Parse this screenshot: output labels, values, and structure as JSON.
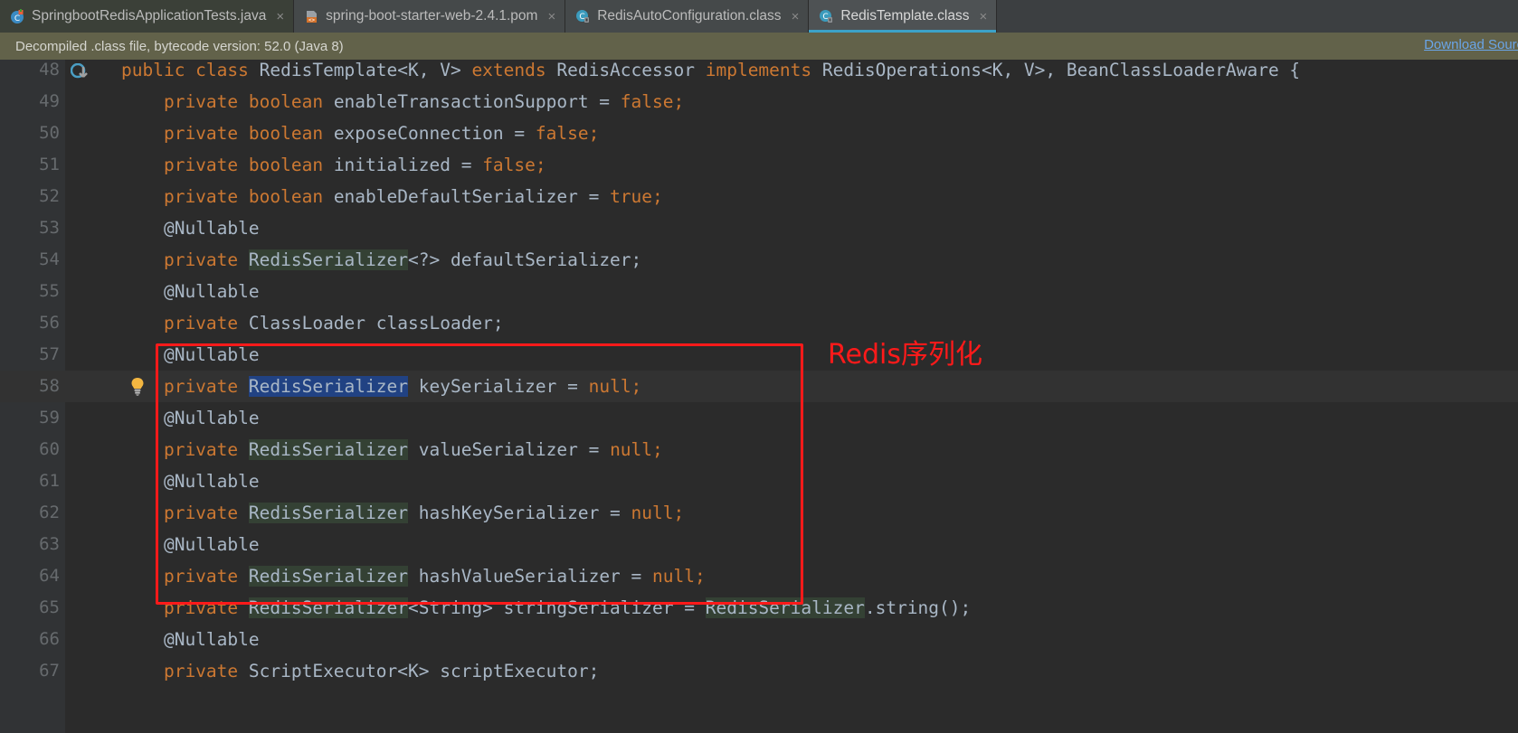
{
  "tabs": [
    {
      "label": "SpringbootRedisApplicationTests.java",
      "icon": "java-class-icon",
      "active": false,
      "style": "inactive-dark",
      "close": "×"
    },
    {
      "label": "spring-boot-starter-web-2.4.1.pom",
      "icon": "maven-pom-icon",
      "active": false,
      "style": "inactive-grey",
      "close": "×"
    },
    {
      "label": "RedisAutoConfiguration.class",
      "icon": "compiled-class-icon",
      "active": false,
      "style": "inactive-grey",
      "close": "×"
    },
    {
      "label": "RedisTemplate.class",
      "icon": "compiled-class-icon",
      "active": true,
      "style": "active",
      "close": "×"
    }
  ],
  "banner": {
    "message": "Decompiled .class file, bytecode version: 52.0 (Java 8)",
    "link": "Download Sources"
  },
  "annotation": {
    "label": "Redis序列化",
    "color": "#ff1a1a"
  },
  "editor": {
    "first_line_number": 48,
    "selection": "RedisSerializer",
    "highlighted_line": 58,
    "bulb_line": 58,
    "lines": [
      {
        "n": "48",
        "segments": [
          {
            "t": "public class ",
            "c": "kw"
          },
          {
            "t": "RedisTemplate<K, V> ",
            "c": "txt"
          },
          {
            "t": "extends ",
            "c": "kw"
          },
          {
            "t": "RedisAccessor ",
            "c": "txt"
          },
          {
            "t": "implements ",
            "c": "kw"
          },
          {
            "t": "RedisOperations<K, V>, BeanClassLoaderAware {",
            "c": "txt"
          }
        ]
      },
      {
        "n": "49",
        "segments": [
          {
            "t": "    private boolean ",
            "c": "kw"
          },
          {
            "t": "enableTransactionSupport = ",
            "c": "txt"
          },
          {
            "t": "false;",
            "c": "kw"
          }
        ]
      },
      {
        "n": "50",
        "segments": [
          {
            "t": "    private boolean ",
            "c": "kw"
          },
          {
            "t": "exposeConnection = ",
            "c": "txt"
          },
          {
            "t": "false;",
            "c": "kw"
          }
        ]
      },
      {
        "n": "51",
        "segments": [
          {
            "t": "    private boolean ",
            "c": "kw"
          },
          {
            "t": "initialized = ",
            "c": "txt"
          },
          {
            "t": "false;",
            "c": "kw"
          }
        ]
      },
      {
        "n": "52",
        "segments": [
          {
            "t": "    private boolean ",
            "c": "kw"
          },
          {
            "t": "enableDefaultSerializer = ",
            "c": "txt"
          },
          {
            "t": "true;",
            "c": "kw"
          }
        ]
      },
      {
        "n": "53",
        "segments": [
          {
            "t": "    @Nullable",
            "c": "txt"
          }
        ]
      },
      {
        "n": "54",
        "segments": [
          {
            "t": "    private ",
            "c": "kw"
          },
          {
            "t": "RedisSerializer",
            "c": "usage"
          },
          {
            "t": "<?> defaultSerializer;",
            "c": "txt"
          }
        ]
      },
      {
        "n": "55",
        "segments": [
          {
            "t": "    @Nullable",
            "c": "txt"
          }
        ]
      },
      {
        "n": "56",
        "segments": [
          {
            "t": "    private ",
            "c": "kw"
          },
          {
            "t": "ClassLoader classLoader;",
            "c": "txt"
          }
        ]
      },
      {
        "n": "57",
        "segments": [
          {
            "t": "    @Nullable",
            "c": "txt"
          }
        ]
      },
      {
        "n": "58",
        "segments": [
          {
            "t": "    private ",
            "c": "kw"
          },
          {
            "t": "RedisSerializer",
            "c": "sel"
          },
          {
            "t": " keySerializer = ",
            "c": "txt"
          },
          {
            "t": "null;",
            "c": "kw"
          }
        ]
      },
      {
        "n": "59",
        "segments": [
          {
            "t": "    @Nullable",
            "c": "txt"
          }
        ]
      },
      {
        "n": "60",
        "segments": [
          {
            "t": "    private ",
            "c": "kw"
          },
          {
            "t": "RedisSerializer",
            "c": "usage"
          },
          {
            "t": " valueSerializer = ",
            "c": "txt"
          },
          {
            "t": "null;",
            "c": "kw"
          }
        ]
      },
      {
        "n": "61",
        "segments": [
          {
            "t": "    @Nullable",
            "c": "txt"
          }
        ]
      },
      {
        "n": "62",
        "segments": [
          {
            "t": "    private ",
            "c": "kw"
          },
          {
            "t": "RedisSerializer",
            "c": "usage"
          },
          {
            "t": " hashKeySerializer = ",
            "c": "txt"
          },
          {
            "t": "null;",
            "c": "kw"
          }
        ]
      },
      {
        "n": "63",
        "segments": [
          {
            "t": "    @Nullable",
            "c": "txt"
          }
        ]
      },
      {
        "n": "64",
        "segments": [
          {
            "t": "    private ",
            "c": "kw"
          },
          {
            "t": "RedisSerializer",
            "c": "usage"
          },
          {
            "t": " hashValueSerializer = ",
            "c": "txt"
          },
          {
            "t": "null;",
            "c": "kw"
          }
        ]
      },
      {
        "n": "65",
        "segments": [
          {
            "t": "    private ",
            "c": "kw"
          },
          {
            "t": "RedisSerializer",
            "c": "usage"
          },
          {
            "t": "<String> stringSerializer = ",
            "c": "txt"
          },
          {
            "t": "RedisSerializer",
            "c": "usage"
          },
          {
            "t": ".string();",
            "c": "txt"
          }
        ]
      },
      {
        "n": "66",
        "segments": [
          {
            "t": "    @Nullable",
            "c": "txt"
          }
        ]
      },
      {
        "n": "67",
        "segments": [
          {
            "t": "    private ",
            "c": "kw"
          },
          {
            "t": "ScriptExecutor<K> scriptExecutor;",
            "c": "txt"
          }
        ]
      }
    ]
  }
}
